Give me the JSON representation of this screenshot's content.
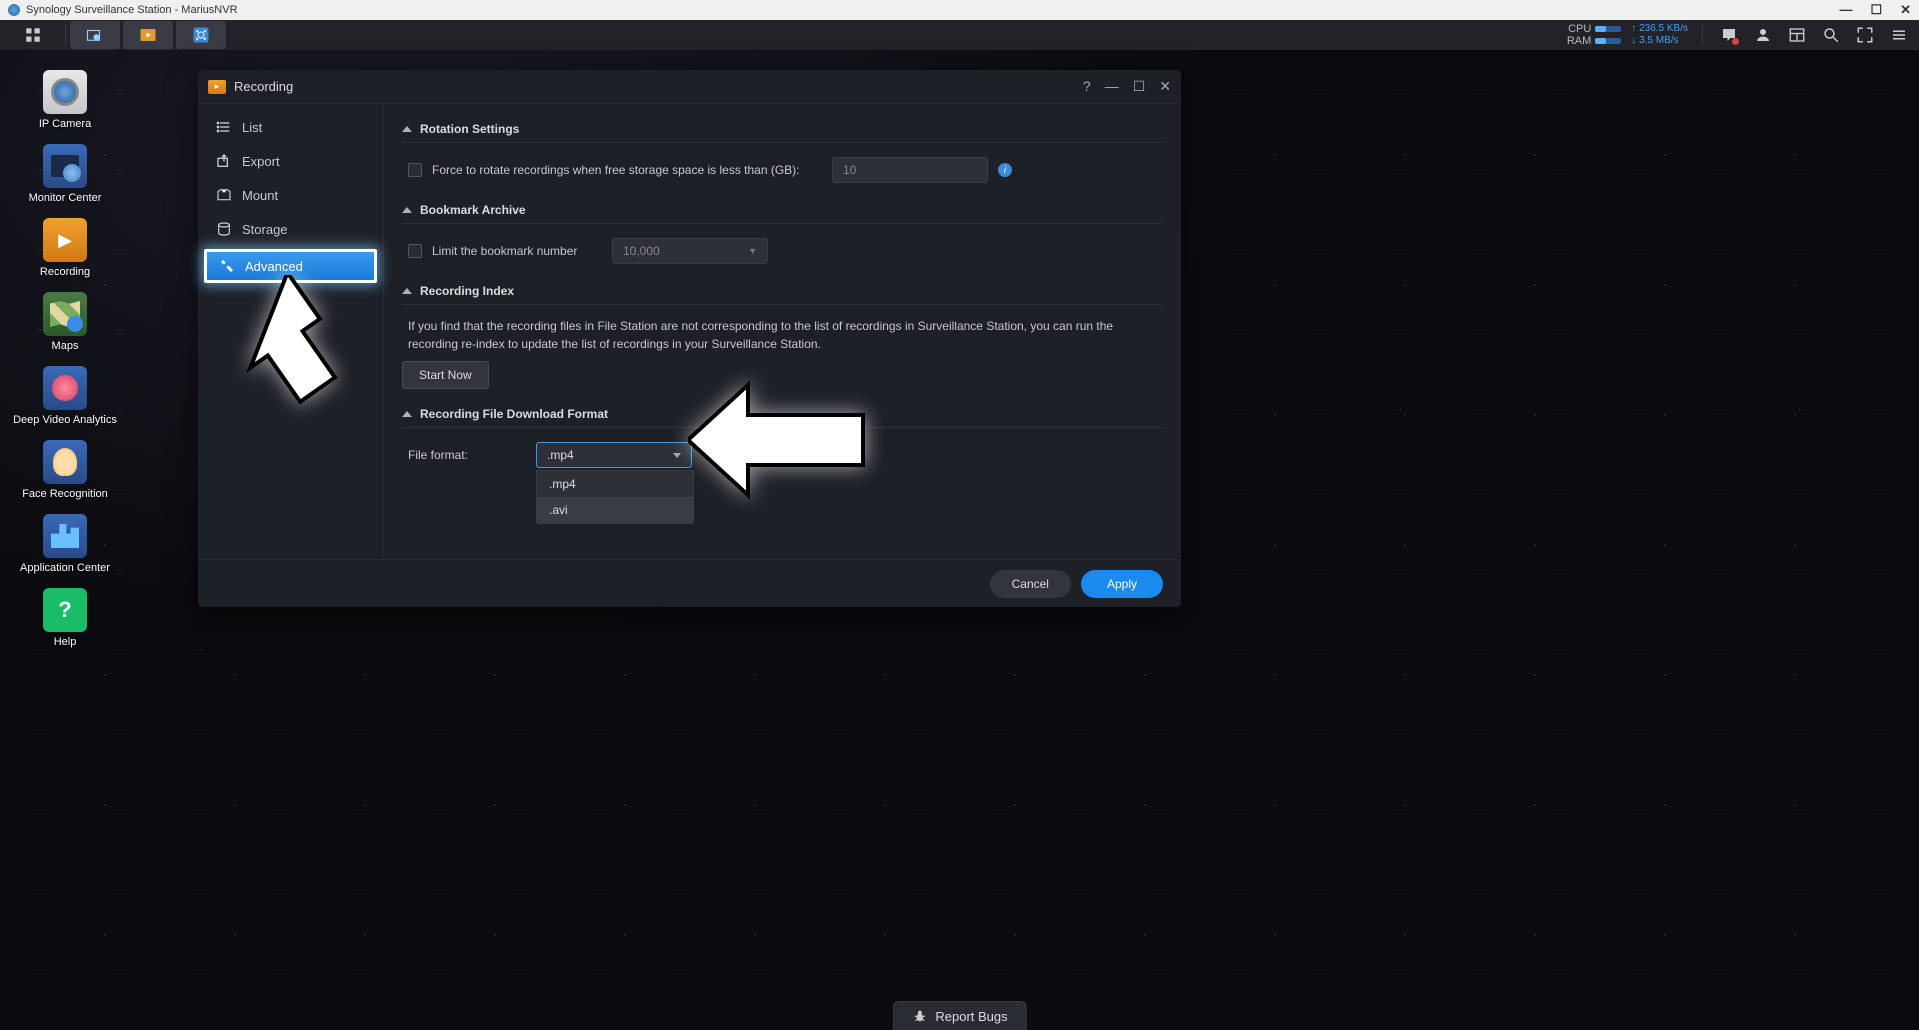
{
  "titlebar": {
    "text": "Synology Surveillance Station - MariusNVR"
  },
  "taskbar": {
    "cpu_label": "CPU",
    "ram_label": "RAM",
    "net_up": "236.5 KB/s",
    "net_dn": "3.5 MB/s"
  },
  "desktop_icons": [
    {
      "label": "IP Camera"
    },
    {
      "label": "Monitor Center"
    },
    {
      "label": "Recording"
    },
    {
      "label": "Maps"
    },
    {
      "label": "Deep Video Analytics"
    },
    {
      "label": "Face Recognition"
    },
    {
      "label": "Application Center"
    },
    {
      "label": "Help"
    }
  ],
  "window": {
    "title": "Recording",
    "sidebar": [
      {
        "label": "List"
      },
      {
        "label": "Export"
      },
      {
        "label": "Mount"
      },
      {
        "label": "Storage"
      },
      {
        "label": "Advanced"
      }
    ],
    "sections": {
      "rotation": {
        "title": "Rotation Settings",
        "checkbox_label": "Force to rotate recordings when free storage space is less than (GB):",
        "value": "10"
      },
      "bookmark": {
        "title": "Bookmark Archive",
        "checkbox_label": "Limit the bookmark number",
        "value": "10,000"
      },
      "index": {
        "title": "Recording Index",
        "description": "If you find that the recording files in File Station are not corresponding to the list of recordings in Surveillance Station, you can run the recording re-index to update the list of recordings in your Surveillance Station.",
        "button": "Start Now"
      },
      "format": {
        "title": "Recording File Download Format",
        "label": "File format:",
        "selected": ".mp4",
        "options": [
          ".mp4",
          ".avi"
        ]
      }
    },
    "footer": {
      "cancel": "Cancel",
      "apply": "Apply"
    }
  },
  "report_bugs": "Report Bugs"
}
